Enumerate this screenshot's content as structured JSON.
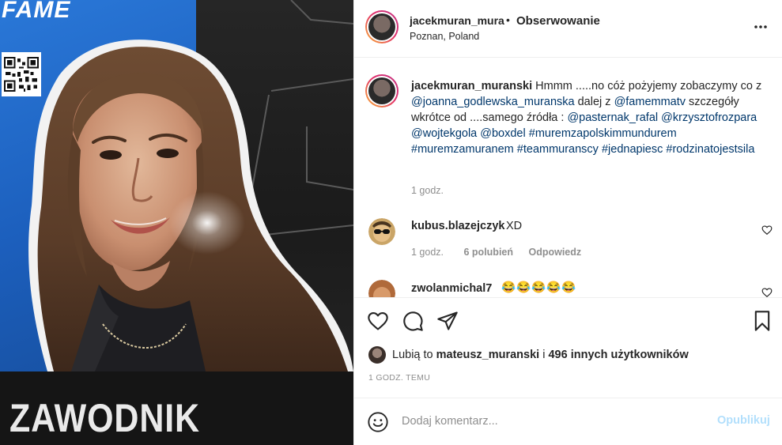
{
  "photo": {
    "logo_text": "FAME",
    "banner_text": "ZAWODNIK"
  },
  "header": {
    "username": "jacekmuran_muranski",
    "dot": "•",
    "follow_label": "Obserwowanie",
    "location": "Poznan, Poland"
  },
  "caption": {
    "user": "jacekmuran_muranski",
    "t1": " Hmmm .....no cóż pożyjemy zobaczymy co z ",
    "m1": "@joanna_godlewska_muranska",
    "t2": " dalej z ",
    "m2": "@famemmatv",
    "t3": " szczegóły wkrótce od ....samego źródła : ",
    "m3": "@pasternak_rafal",
    "m4": "@krzysztofrozpara",
    "m5": "@wojtekgola",
    "m6": "@boxdel",
    "h1": "#muremzapolskimmundurem",
    "h2": "#muremzamuranem",
    "h3": "#teammuranscy",
    "h4": "#jednapiesc",
    "h5": "#rodzinatojestsila",
    "time": "1 godz."
  },
  "comments": [
    {
      "user": "kubus.blazejczyk",
      "text": "XD",
      "time": "1 godz.",
      "likes": "6 polubień",
      "reply": "Odpowiedz"
    },
    {
      "user": "zwolanmichal7",
      "text": "😂😂😂😂😂"
    }
  ],
  "likes": {
    "prefix": "Lubią to ",
    "user": "mateusz_muranski",
    "middle": " i ",
    "others": "496 innych użytkowników"
  },
  "posted": "1 GODZ. TEMU",
  "add_comment": {
    "placeholder": "Dodaj komentarz...",
    "publish_label": "Opublikuj"
  },
  "icons": [
    "more-icon",
    "heart-icon",
    "comment-icon",
    "share-icon",
    "bookmark-icon",
    "emoji-icon"
  ],
  "colors": {
    "mention": "#00376b",
    "secondary_text": "#8e8e8e",
    "publish_disabled": "#b2dffc",
    "photo_blue": "#1c5fbd"
  }
}
